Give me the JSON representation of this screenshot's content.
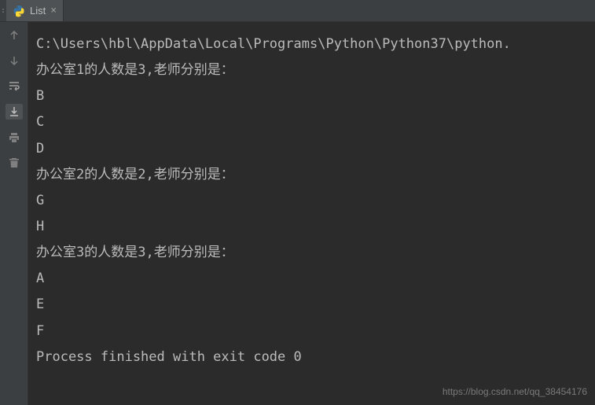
{
  "tab": {
    "label": "List",
    "close": "×",
    "leading": ":"
  },
  "console": {
    "lines": [
      "C:\\Users\\hbl\\AppData\\Local\\Programs\\Python\\Python37\\python.",
      "办公室1的人数是3,老师分别是：",
      "B",
      "C",
      "D",
      "办公室2的人数是2,老师分别是：",
      "G",
      "H",
      "办公室3的人数是3,老师分别是：",
      "A",
      "E",
      "F",
      "",
      "Process finished with exit code 0"
    ]
  },
  "watermark": "https://blog.csdn.net/qq_38454176"
}
